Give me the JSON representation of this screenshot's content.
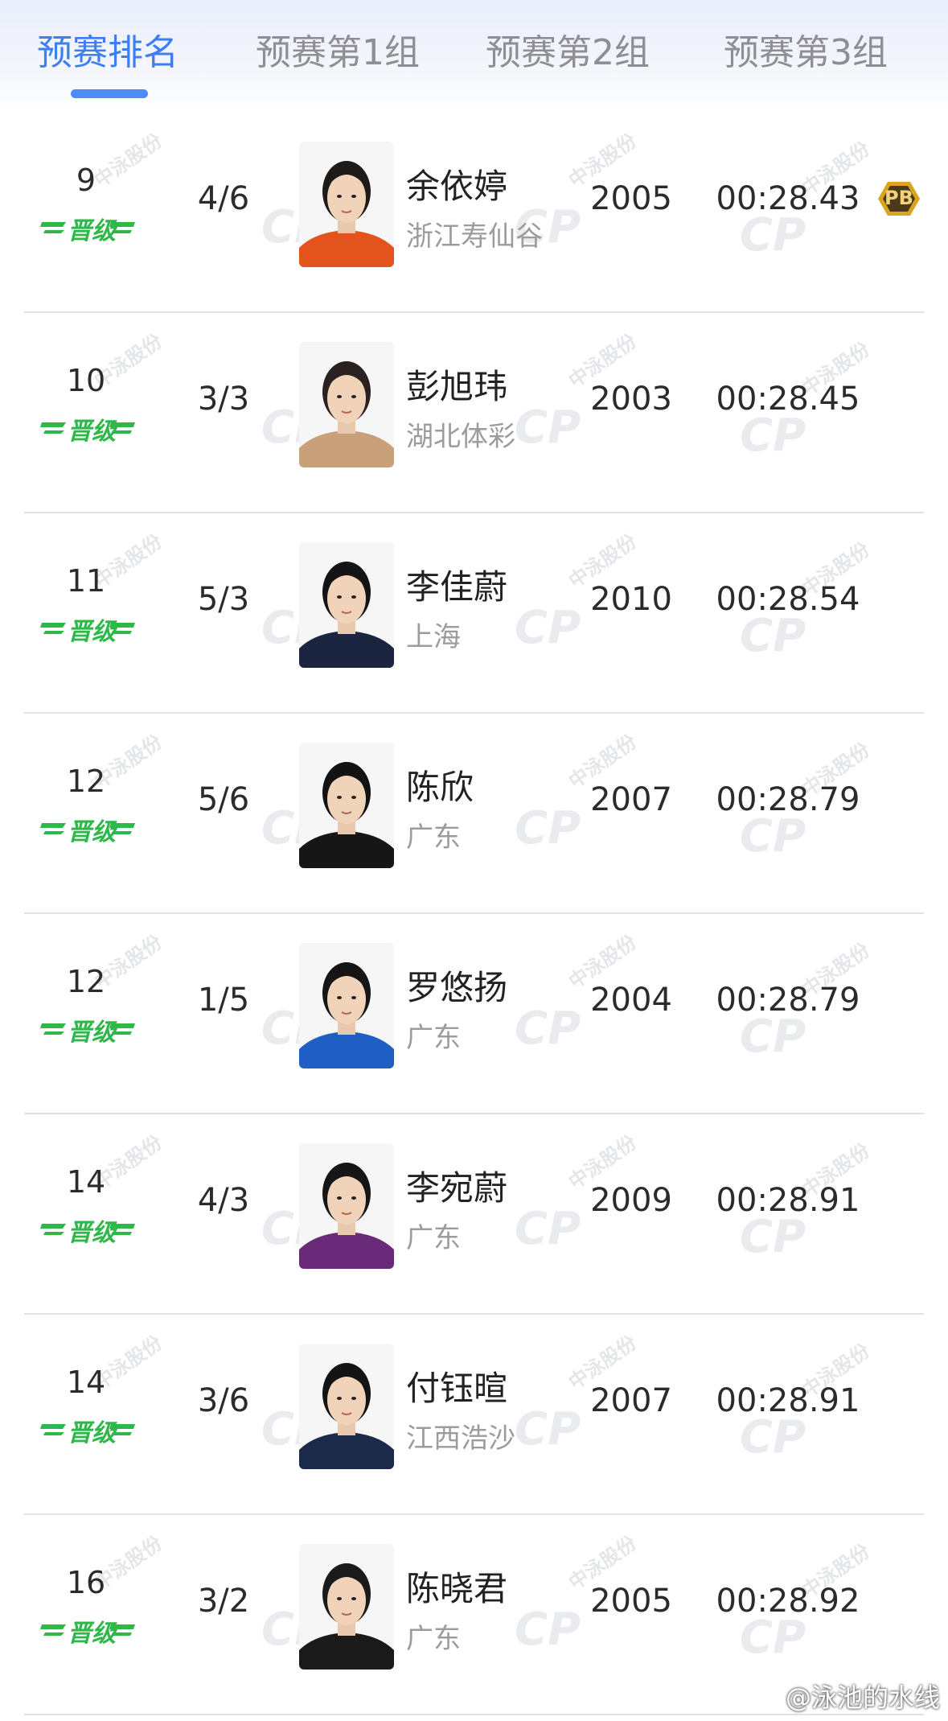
{
  "tabs": [
    {
      "label": "预赛排名",
      "active": true
    },
    {
      "label": "预赛第1组",
      "active": false
    },
    {
      "label": "预赛第2组",
      "active": false
    },
    {
      "label": "预赛第3组",
      "active": false
    }
  ],
  "colors": {
    "accent": "#3d7ff0",
    "advance_green": "#2fb84a",
    "pb_gold": "#d9a51f"
  },
  "advance_label": "晋级",
  "pb_label": "PB",
  "watermark": {
    "brand": "中泳股份",
    "logo": "CP"
  },
  "athletes": [
    {
      "rank": "9",
      "heat_lane": "4/6",
      "name": "余依婷",
      "team": "浙江寿仙谷",
      "birth_year": "2005",
      "time": "00:28.43",
      "pb": true,
      "shirt": "#e2541c",
      "hair": "#1e1a18"
    },
    {
      "rank": "10",
      "heat_lane": "3/3",
      "name": "彭旭玮",
      "team": "湖北体彩",
      "birth_year": "2003",
      "time": "00:28.45",
      "pb": false,
      "shirt": "#c8a07a",
      "hair": "#2a2220"
    },
    {
      "rank": "11",
      "heat_lane": "5/3",
      "name": "李佳蔚",
      "team": "上海",
      "birth_year": "2010",
      "time": "00:28.54",
      "pb": false,
      "shirt": "#1c2540",
      "hair": "#141414"
    },
    {
      "rank": "12",
      "heat_lane": "5/6",
      "name": "陈欣",
      "team": "广东",
      "birth_year": "2007",
      "time": "00:28.79",
      "pb": false,
      "shirt": "#161616",
      "hair": "#121212"
    },
    {
      "rank": "12",
      "heat_lane": "1/5",
      "name": "罗悠扬",
      "team": "广东",
      "birth_year": "2004",
      "time": "00:28.79",
      "pb": false,
      "shirt": "#1f5fc4",
      "hair": "#151515"
    },
    {
      "rank": "14",
      "heat_lane": "4/3",
      "name": "李宛蔚",
      "team": "广东",
      "birth_year": "2009",
      "time": "00:28.91",
      "pb": false,
      "shirt": "#6a2a7a",
      "hair": "#161616"
    },
    {
      "rank": "14",
      "heat_lane": "3/6",
      "name": "付钰暄",
      "team": "江西浩沙",
      "birth_year": "2007",
      "time": "00:28.91",
      "pb": false,
      "shirt": "#1c2a4a",
      "hair": "#141414"
    },
    {
      "rank": "16",
      "heat_lane": "3/2",
      "name": "陈晓君",
      "team": "广东",
      "birth_year": "2005",
      "time": "00:28.92",
      "pb": false,
      "shirt": "#1a1a1a",
      "hair": "#1a1a1a"
    }
  ],
  "weibo_watermark": "@泳池的水线"
}
